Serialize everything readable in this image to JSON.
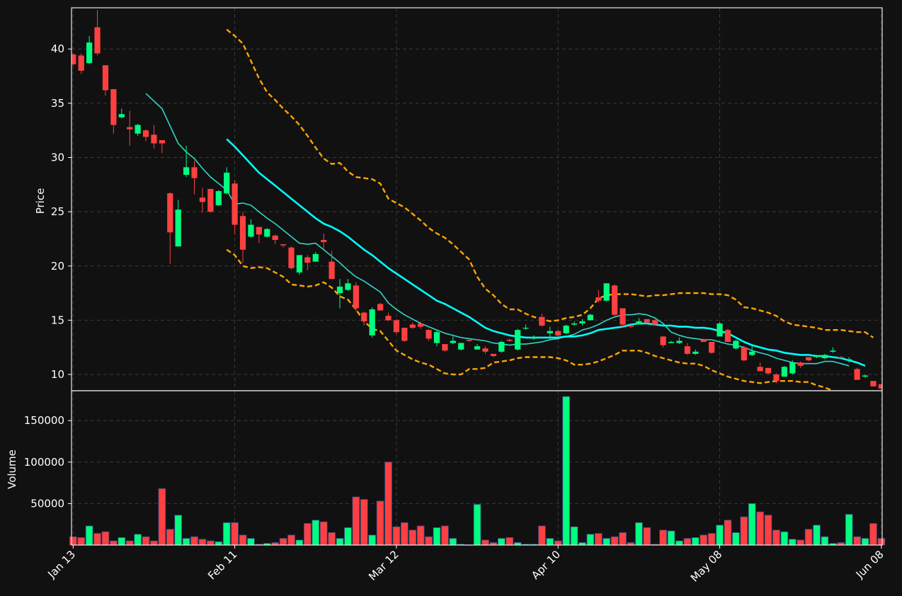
{
  "chart_data": {
    "type": "candlestick",
    "colors": {
      "background": "#111111",
      "up": "#00ff7f",
      "down": "#ff4040",
      "sma_fast": "#2fd6c6",
      "sma_slow": "#00ffff",
      "bands": "#ffa500",
      "grid": "#3a3a3a",
      "text": "#ffffff"
    },
    "price_panel": {
      "ylabel": "Price",
      "ylim": [
        8.5,
        43.8
      ],
      "yticks": [
        10,
        15,
        20,
        25,
        30,
        35,
        40
      ],
      "ytick_labels": [
        "10",
        "15",
        "20",
        "25",
        "30",
        "35",
        "40"
      ]
    },
    "volume_panel": {
      "ylabel": "Volume",
      "ylim": [
        0,
        186000
      ],
      "yticks": [
        50000,
        100000,
        150000
      ],
      "ytick_labels": [
        "50000",
        "100000",
        "150000"
      ]
    },
    "x_axis": {
      "tick_indices": [
        0,
        20,
        40,
        60,
        80,
        100
      ],
      "tick_labels": [
        "Jan 13",
        "Feb 11",
        "Mar 12",
        "Apr 10",
        "May 08",
        "Jun 08"
      ],
      "xlim": [
        -0.2,
        100.1
      ],
      "grid": true
    },
    "candles": [
      {
        "date": "Jan 13",
        "o": 39.5,
        "h": 39.6,
        "l": 38.5,
        "c": 38.6,
        "v": 10000
      },
      {
        "date": "Jan 14",
        "o": 39.4,
        "h": 39.6,
        "l": 37.7,
        "c": 38.0,
        "v": 9000
      },
      {
        "date": "Jan 15",
        "o": 38.7,
        "h": 41.2,
        "l": 38.6,
        "c": 40.6,
        "v": 23000
      },
      {
        "date": "Jan 16",
        "o": 42.0,
        "h": 43.6,
        "l": 39.4,
        "c": 39.6,
        "v": 14000
      },
      {
        "date": "Jan 17",
        "o": 38.5,
        "h": 38.5,
        "l": 35.7,
        "c": 36.2,
        "v": 16000
      },
      {
        "date": "Jan 20",
        "o": 36.3,
        "h": 36.3,
        "l": 32.2,
        "c": 33.0,
        "v": 5000
      },
      {
        "date": "Jan 21",
        "o": 33.7,
        "h": 34.5,
        "l": 33.6,
        "c": 34.0,
        "v": 9000
      },
      {
        "date": "Jan 22",
        "o": 32.8,
        "h": 34.3,
        "l": 31.1,
        "c": 32.6,
        "v": 5000
      },
      {
        "date": "Jan 23",
        "o": 32.2,
        "h": 33.1,
        "l": 32.0,
        "c": 33.0,
        "v": 13000
      },
      {
        "date": "Jan 24",
        "o": 32.5,
        "h": 32.6,
        "l": 31.5,
        "c": 31.9,
        "v": 10000
      },
      {
        "date": "Jan 27",
        "o": 32.1,
        "h": 33.0,
        "l": 30.8,
        "c": 31.3,
        "v": 5000
      },
      {
        "date": "Jan 28",
        "o": 31.6,
        "h": 31.6,
        "l": 30.4,
        "c": 31.3,
        "v": 68000
      },
      {
        "date": "Jan 29",
        "o": 26.7,
        "h": 26.8,
        "l": 20.2,
        "c": 23.1,
        "v": 19000
      },
      {
        "date": "Jan 30",
        "o": 21.8,
        "h": 26.1,
        "l": 21.8,
        "c": 25.2,
        "v": 36000
      },
      {
        "date": "Jan 31",
        "o": 28.4,
        "h": 31.1,
        "l": 28.2,
        "c": 29.1,
        "v": 8000
      },
      {
        "date": "Feb 03",
        "o": 29.1,
        "h": 29.7,
        "l": 26.6,
        "c": 28.1,
        "v": 10000
      },
      {
        "date": "Feb 04",
        "o": 26.3,
        "h": 27.2,
        "l": 24.9,
        "c": 25.9,
        "v": 7000
      },
      {
        "date": "Feb 05",
        "o": 27.1,
        "h": 27.1,
        "l": 24.9,
        "c": 25.0,
        "v": 5000
      },
      {
        "date": "Feb 06",
        "o": 25.6,
        "h": 27.0,
        "l": 25.5,
        "c": 26.9,
        "v": 4000
      },
      {
        "date": "Feb 07",
        "o": 26.7,
        "h": 29.1,
        "l": 26.6,
        "c": 28.6,
        "v": 27000
      },
      {
        "date": "Feb 11",
        "o": 27.6,
        "h": 27.9,
        "l": 22.9,
        "c": 23.8,
        "v": 27000
      },
      {
        "date": "Feb 12",
        "o": 24.6,
        "h": 25.0,
        "l": 20.3,
        "c": 21.5,
        "v": 12000
      },
      {
        "date": "Feb 13",
        "o": 22.7,
        "h": 24.3,
        "l": 22.6,
        "c": 23.8,
        "v": 8000
      },
      {
        "date": "Feb 14",
        "o": 23.6,
        "h": 23.6,
        "l": 22.1,
        "c": 22.9,
        "v": 1000
      },
      {
        "date": "Feb 17",
        "o": 22.7,
        "h": 23.5,
        "l": 22.6,
        "c": 23.4,
        "v": 2000
      },
      {
        "date": "Feb 18",
        "o": 22.8,
        "h": 22.9,
        "l": 22.0,
        "c": 22.4,
        "v": 3000
      },
      {
        "date": "Feb 19",
        "o": 22.0,
        "h": 22.0,
        "l": 21.7,
        "c": 21.9,
        "v": 8000
      },
      {
        "date": "Feb 20",
        "o": 21.7,
        "h": 21.8,
        "l": 19.7,
        "c": 19.8,
        "v": 12000
      },
      {
        "date": "Feb 21",
        "o": 19.4,
        "h": 21.0,
        "l": 19.2,
        "c": 21.0,
        "v": 6000
      },
      {
        "date": "Feb 24",
        "o": 20.8,
        "h": 21.0,
        "l": 19.6,
        "c": 20.3,
        "v": 26000
      },
      {
        "date": "Feb 25",
        "o": 20.4,
        "h": 21.3,
        "l": 20.4,
        "c": 21.1,
        "v": 30000
      },
      {
        "date": "Feb 26",
        "o": 22.4,
        "h": 23.0,
        "l": 21.4,
        "c": 22.2,
        "v": 28000
      },
      {
        "date": "Feb 27",
        "o": 20.4,
        "h": 21.4,
        "l": 18.9,
        "c": 18.8,
        "v": 15000
      },
      {
        "date": "Feb 28",
        "o": 17.5,
        "h": 18.8,
        "l": 16.1,
        "c": 18.1,
        "v": 8000
      },
      {
        "date": "Mar 03",
        "o": 17.8,
        "h": 18.8,
        "l": 17.7,
        "c": 18.4,
        "v": 21000
      },
      {
        "date": "Mar 04",
        "o": 18.2,
        "h": 18.5,
        "l": 15.8,
        "c": 16.1,
        "v": 58000
      },
      {
        "date": "Mar 05",
        "o": 15.7,
        "h": 15.8,
        "l": 14.5,
        "c": 14.9,
        "v": 55000
      },
      {
        "date": "Mar 06",
        "o": 13.6,
        "h": 16.2,
        "l": 13.4,
        "c": 16.0,
        "v": 12000
      },
      {
        "date": "Mar 07",
        "o": 16.5,
        "h": 16.6,
        "l": 15.9,
        "c": 15.9,
        "v": 53000
      },
      {
        "date": "Mar 10",
        "o": 15.4,
        "h": 15.7,
        "l": 14.9,
        "c": 15.0,
        "v": 100000
      },
      {
        "date": "Mar 12",
        "o": 15.0,
        "h": 15.1,
        "l": 13.7,
        "c": 13.9,
        "v": 22000
      },
      {
        "date": "Mar 13",
        "o": 14.3,
        "h": 14.3,
        "l": 13.0,
        "c": 13.1,
        "v": 27000
      },
      {
        "date": "Mar 14",
        "o": 14.6,
        "h": 14.8,
        "l": 14.2,
        "c": 14.3,
        "v": 18000
      },
      {
        "date": "Mar 17",
        "o": 14.7,
        "h": 14.9,
        "l": 14.2,
        "c": 14.4,
        "v": 23000
      },
      {
        "date": "Mar 18",
        "o": 14.1,
        "h": 14.2,
        "l": 13.1,
        "c": 13.3,
        "v": 10000
      },
      {
        "date": "Mar 19",
        "o": 12.9,
        "h": 14.1,
        "l": 12.6,
        "c": 13.9,
        "v": 21000
      },
      {
        "date": "Mar 20",
        "o": 12.8,
        "h": 12.8,
        "l": 12.1,
        "c": 12.2,
        "v": 23000
      },
      {
        "date": "Mar 21",
        "o": 12.9,
        "h": 13.5,
        "l": 12.8,
        "c": 13.1,
        "v": 8000
      },
      {
        "date": "Mar 24",
        "o": 12.3,
        "h": 12.9,
        "l": 12.2,
        "c": 12.9,
        "v": 1000
      },
      {
        "date": "Mar 25",
        "o": 13.2,
        "h": 13.2,
        "l": 13.0,
        "c": 13.1,
        "v": 0
      },
      {
        "date": "Mar 26",
        "o": 12.3,
        "h": 12.8,
        "l": 12.3,
        "c": 12.6,
        "v": 49000
      },
      {
        "date": "Mar 27",
        "o": 12.4,
        "h": 12.6,
        "l": 11.9,
        "c": 12.1,
        "v": 6000
      },
      {
        "date": "Mar 28",
        "o": 11.9,
        "h": 11.9,
        "l": 11.6,
        "c": 11.7,
        "v": 3000
      },
      {
        "date": "Mar 31",
        "o": 12.1,
        "h": 13.1,
        "l": 12.0,
        "c": 13.0,
        "v": 8000
      },
      {
        "date": "Apr 01",
        "o": 13.2,
        "h": 13.3,
        "l": 13.0,
        "c": 13.1,
        "v": 9000
      },
      {
        "date": "Apr 02",
        "o": 12.3,
        "h": 14.2,
        "l": 12.2,
        "c": 14.1,
        "v": 3000
      },
      {
        "date": "Apr 03",
        "o": 14.3,
        "h": 14.6,
        "l": 14.1,
        "c": 14.3,
        "v": 1000
      },
      {
        "date": "Apr 04",
        "o": 13.3,
        "h": 13.6,
        "l": 13.2,
        "c": 13.4,
        "v": 1000
      },
      {
        "date": "Apr 07",
        "o": 15.3,
        "h": 15.6,
        "l": 14.4,
        "c": 14.5,
        "v": 23000
      },
      {
        "date": "Apr 08",
        "o": 13.8,
        "h": 14.4,
        "l": 13.2,
        "c": 14.0,
        "v": 8000
      },
      {
        "date": "Apr 10",
        "o": 14.0,
        "h": 14.1,
        "l": 13.5,
        "c": 13.6,
        "v": 5000
      },
      {
        "date": "Apr 11",
        "o": 13.8,
        "h": 14.6,
        "l": 13.7,
        "c": 14.5,
        "v": 179000
      },
      {
        "date": "Apr 14",
        "o": 14.6,
        "h": 14.9,
        "l": 14.5,
        "c": 14.7,
        "v": 22000
      },
      {
        "date": "Apr 15",
        "o": 14.7,
        "h": 15.1,
        "l": 14.5,
        "c": 14.9,
        "v": 3000
      },
      {
        "date": "Apr 16",
        "o": 15.0,
        "h": 15.6,
        "l": 15.0,
        "c": 15.5,
        "v": 13000
      },
      {
        "date": "Apr 17",
        "o": 17.1,
        "h": 17.8,
        "l": 16.6,
        "c": 16.8,
        "v": 14000
      },
      {
        "date": "Apr 18",
        "o": 16.8,
        "h": 18.4,
        "l": 16.7,
        "c": 18.4,
        "v": 8000
      },
      {
        "date": "Apr 21",
        "o": 18.2,
        "h": 18.3,
        "l": 15.4,
        "c": 15.5,
        "v": 10000
      },
      {
        "date": "Apr 22",
        "o": 16.1,
        "h": 16.1,
        "l": 14.3,
        "c": 14.6,
        "v": 15000
      },
      {
        "date": "Apr 23",
        "o": 14.5,
        "h": 14.6,
        "l": 14.3,
        "c": 14.4,
        "v": 3000
      },
      {
        "date": "Apr 24",
        "o": 14.6,
        "h": 15.2,
        "l": 14.6,
        "c": 14.9,
        "v": 27000
      },
      {
        "date": "Apr 25",
        "o": 15.1,
        "h": 15.1,
        "l": 14.7,
        "c": 14.8,
        "v": 21000
      },
      {
        "date": "Apr 28",
        "o": 15.0,
        "h": 15.1,
        "l": 14.5,
        "c": 14.6,
        "v": 1000
      },
      {
        "date": "Apr 29",
        "o": 13.5,
        "h": 13.5,
        "l": 12.5,
        "c": 12.7,
        "v": 18000
      },
      {
        "date": "Apr 30",
        "o": 12.9,
        "h": 13.1,
        "l": 12.9,
        "c": 13.0,
        "v": 17000
      },
      {
        "date": "May 01",
        "o": 12.9,
        "h": 13.4,
        "l": 12.8,
        "c": 13.1,
        "v": 5000
      },
      {
        "date": "May 02",
        "o": 12.6,
        "h": 12.9,
        "l": 11.8,
        "c": 11.9,
        "v": 8000
      },
      {
        "date": "May 05",
        "o": 11.9,
        "h": 12.3,
        "l": 11.8,
        "c": 12.1,
        "v": 9000
      },
      {
        "date": "May 06",
        "o": 13.2,
        "h": 13.3,
        "l": 13.0,
        "c": 13.0,
        "v": 12000
      },
      {
        "date": "May 07",
        "o": 13.0,
        "h": 13.0,
        "l": 11.9,
        "c": 12.0,
        "v": 14000
      },
      {
        "date": "May 08",
        "o": 13.5,
        "h": 14.8,
        "l": 13.5,
        "c": 14.7,
        "v": 24000
      },
      {
        "date": "May 09",
        "o": 14.1,
        "h": 14.2,
        "l": 13.0,
        "c": 13.0,
        "v": 30000
      },
      {
        "date": "May 12",
        "o": 12.4,
        "h": 13.2,
        "l": 12.3,
        "c": 13.1,
        "v": 15000
      },
      {
        "date": "May 13",
        "o": 12.5,
        "h": 12.6,
        "l": 11.2,
        "c": 11.3,
        "v": 34000
      },
      {
        "date": "May 14",
        "o": 11.8,
        "h": 12.8,
        "l": 11.7,
        "c": 12.1,
        "v": 50000
      },
      {
        "date": "May 15",
        "o": 10.7,
        "h": 11.1,
        "l": 10.3,
        "c": 10.3,
        "v": 40000
      },
      {
        "date": "May 16",
        "o": 10.6,
        "h": 10.6,
        "l": 10.0,
        "c": 10.1,
        "v": 36000
      },
      {
        "date": "May 19",
        "o": 10.0,
        "h": 10.1,
        "l": 9.2,
        "c": 9.4,
        "v": 18000
      },
      {
        "date": "May 20",
        "o": 9.8,
        "h": 10.8,
        "l": 9.8,
        "c": 10.7,
        "v": 16000
      },
      {
        "date": "May 21",
        "o": 10.1,
        "h": 11.3,
        "l": 10.0,
        "c": 11.1,
        "v": 7000
      },
      {
        "date": "May 22",
        "o": 11.1,
        "h": 11.2,
        "l": 10.6,
        "c": 10.8,
        "v": 6000
      },
      {
        "date": "May 23",
        "o": 11.6,
        "h": 11.6,
        "l": 11.2,
        "c": 11.3,
        "v": 19000
      },
      {
        "date": "May 27",
        "o": 11.6,
        "h": 11.8,
        "l": 11.5,
        "c": 11.7,
        "v": 24000
      },
      {
        "date": "May 28",
        "o": 11.5,
        "h": 11.9,
        "l": 11.4,
        "c": 11.8,
        "v": 10000
      },
      {
        "date": "May 29",
        "o": 12.1,
        "h": 12.5,
        "l": 12.0,
        "c": 12.2,
        "v": 2000
      },
      {
        "date": "May 30",
        "o": 11.6,
        "h": 11.7,
        "l": 11.5,
        "c": 11.5,
        "v": 3000
      },
      {
        "date": "Jun 02",
        "o": 11.3,
        "h": 11.6,
        "l": 11.1,
        "c": 11.4,
        "v": 37000
      },
      {
        "date": "Jun 03",
        "o": 10.5,
        "h": 10.6,
        "l": 9.6,
        "c": 9.5,
        "v": 10000
      },
      {
        "date": "Jun 04",
        "o": 9.8,
        "h": 10.0,
        "l": 9.7,
        "c": 9.9,
        "v": 8000
      },
      {
        "date": "Jun 05",
        "o": 9.4,
        "h": 9.4,
        "l": 8.9,
        "c": 8.9,
        "v": 26000
      },
      {
        "date": "Jun 08",
        "o": 9.1,
        "h": 9.1,
        "l": 8.6,
        "c": 8.7,
        "v": 8000
      }
    ],
    "sma_fast": {
      "start_index": 9,
      "values": [
        35.9,
        35.2,
        34.5,
        32.9,
        31.3,
        30.5,
        29.9,
        29.0,
        28.2,
        27.6,
        27.0,
        25.7,
        25.8,
        25.6,
        25.0,
        24.4,
        23.9,
        23.3,
        22.7,
        22.1,
        22.0,
        22.1,
        21.5,
        20.9,
        20.3,
        19.6,
        19.0,
        18.6,
        18.1,
        17.6,
        16.6,
        16.0,
        15.5,
        15.1,
        14.7,
        14.4,
        14.1,
        13.8,
        13.6,
        13.4,
        13.3,
        13.2,
        13.1,
        12.9,
        12.8,
        12.7,
        12.8,
        12.8,
        12.9,
        13.0,
        13.2,
        13.3,
        13.5,
        13.7,
        14.1,
        14.3,
        14.6,
        15.0,
        15.3,
        15.5,
        15.5,
        15.6,
        15.5,
        15.2,
        14.7,
        13.9,
        13.6,
        13.4,
        13.3,
        13.2,
        13.2,
        13.0,
        12.8,
        12.7,
        12.5,
        12.2,
        12.0,
        11.8,
        11.5,
        11.3,
        11.1,
        11.0,
        11.0,
        11.0,
        11.2,
        11.2,
        11.0,
        10.8
      ]
    },
    "sma_slow": {
      "start_index": 19,
      "values": [
        31.7,
        31.0,
        30.2,
        29.4,
        28.6,
        28.0,
        27.4,
        26.8,
        26.2,
        25.6,
        25.0,
        24.4,
        23.9,
        23.6,
        23.2,
        22.7,
        22.1,
        21.5,
        21.0,
        20.4,
        19.8,
        19.3,
        18.8,
        18.3,
        17.8,
        17.3,
        16.8,
        16.5,
        16.1,
        15.7,
        15.3,
        14.8,
        14.3,
        14.0,
        13.8,
        13.6,
        13.5,
        13.4,
        13.4,
        13.4,
        13.4,
        13.4,
        13.5,
        13.5,
        13.6,
        13.8,
        14.1,
        14.2,
        14.3,
        14.4,
        14.6,
        14.7,
        14.7,
        14.6,
        14.5,
        14.5,
        14.4,
        14.4,
        14.3,
        14.3,
        14.2,
        14.0,
        13.8,
        13.4,
        13.0,
        12.7,
        12.5,
        12.3,
        12.2,
        12.0,
        11.9,
        11.8,
        11.8,
        11.7,
        11.7,
        11.6,
        11.5,
        11.3,
        11.1,
        10.8
      ]
    },
    "band_upper": {
      "start_index": 19,
      "values": [
        41.8,
        41.2,
        40.5,
        38.9,
        37.3,
        36.0,
        35.3,
        34.5,
        33.8,
        33.0,
        32.0,
        30.9,
        29.9,
        29.4,
        29.5,
        28.7,
        28.2,
        28.1,
        28.0,
        27.6,
        26.2,
        25.8,
        25.4,
        24.8,
        24.2,
        23.5,
        23.0,
        22.6,
        22.0,
        21.3,
        20.6,
        19.0,
        17.9,
        17.3,
        16.5,
        16.0,
        16.0,
        15.6,
        15.3,
        15.1,
        14.9,
        15.0,
        15.2,
        15.3,
        15.5,
        16.1,
        17.0,
        17.3,
        17.4,
        17.4,
        17.4,
        17.3,
        17.2,
        17.3,
        17.3,
        17.4,
        17.5,
        17.5,
        17.5,
        17.5,
        17.4,
        17.4,
        17.3,
        16.9,
        16.2,
        16.1,
        15.9,
        15.7,
        15.4,
        14.9,
        14.6,
        14.5,
        14.4,
        14.3,
        14.1,
        14.1,
        14.1,
        14.0,
        13.9,
        13.9,
        13.4
      ]
    },
    "band_lower": {
      "start_index": 19,
      "values": [
        21.5,
        21.0,
        20.0,
        19.8,
        19.9,
        19.8,
        19.4,
        19.0,
        18.3,
        18.2,
        18.1,
        18.2,
        18.5,
        18.0,
        17.2,
        16.9,
        16.0,
        14.9,
        14.2,
        14.0,
        13.1,
        12.2,
        11.8,
        11.4,
        11.1,
        10.9,
        10.5,
        10.1,
        10.0,
        10.0,
        10.5,
        10.5,
        10.6,
        11.1,
        11.2,
        11.3,
        11.5,
        11.6,
        11.6,
        11.6,
        11.6,
        11.5,
        11.3,
        10.9,
        10.9,
        11.0,
        11.2,
        11.5,
        11.8,
        12.2,
        12.2,
        12.2,
        12.0,
        11.7,
        11.5,
        11.3,
        11.1,
        11.0,
        11.0,
        10.8,
        10.4,
        10.1,
        9.8,
        9.6,
        9.4,
        9.3,
        9.2,
        9.3,
        9.4,
        9.4,
        9.4,
        9.3,
        9.3,
        9.0,
        8.8,
        8.5,
        8.2
      ]
    }
  }
}
